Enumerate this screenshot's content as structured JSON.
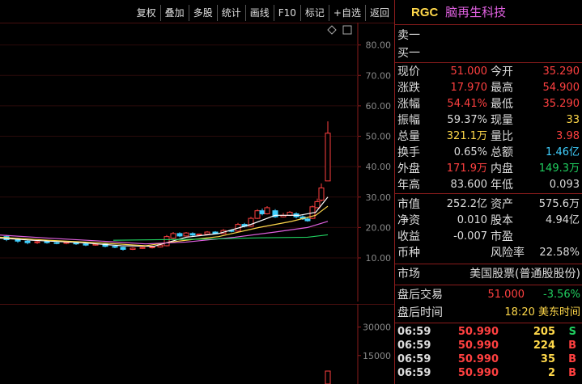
{
  "toolbar": {
    "buttons": [
      "复权",
      "叠加",
      "多股",
      "统计",
      "画线",
      "F10",
      "标记",
      "+自选",
      "返回"
    ]
  },
  "chart": {
    "price_axis": [
      "80.00",
      "70.00",
      "60.00",
      "50.00",
      "40.00",
      "30.00",
      "20.00",
      "10.00"
    ],
    "volume_axis": [
      "30000",
      "15000"
    ]
  },
  "header": {
    "code": "RGC",
    "name": "脑再生科技"
  },
  "orderbook": {
    "sell1": "卖一",
    "buy1": "买一"
  },
  "quote": [
    {
      "l1": "现价",
      "v1": "51.000",
      "c1": "red",
      "l2": "今开",
      "v2": "35.290",
      "c2": "red"
    },
    {
      "l1": "涨跌",
      "v1": "17.970",
      "c1": "red",
      "l2": "最高",
      "v2": "54.900",
      "c2": "red"
    },
    {
      "l1": "涨幅",
      "v1": "54.41%",
      "c1": "red",
      "l2": "最低",
      "v2": "35.290",
      "c2": "red"
    },
    {
      "l1": "振幅",
      "v1": "59.37%",
      "c1": "white",
      "l2": "现量",
      "v2": "33",
      "c2": "yellow"
    },
    {
      "l1": "总量",
      "v1": "321.1万",
      "c1": "yellow",
      "l2": "量比",
      "v2": "3.98",
      "c2": "red"
    },
    {
      "l1": "换手",
      "v1": "0.65%",
      "c1": "white",
      "l2": "总额",
      "v2": "1.46亿",
      "c2": "cyan"
    },
    {
      "l1": "外盘",
      "v1": "171.9万",
      "c1": "red",
      "l2": "内盘",
      "v2": "149.3万",
      "c2": "green"
    },
    {
      "l1": "年高",
      "v1": "83.600",
      "c1": "white",
      "l2": "年低",
      "v2": "0.093",
      "c2": "white"
    }
  ],
  "metrics": [
    {
      "l1": "市值",
      "v1": "252.2亿",
      "l2": "资产",
      "v2": "575.6万"
    },
    {
      "l1": "净资",
      "v1": "0.010",
      "l2": "股本",
      "v2": "4.94亿"
    },
    {
      "l1": "收益",
      "v1": "-0.007",
      "l2": "市盈",
      "v2": ""
    },
    {
      "l1": "币种",
      "v1": "",
      "l2": "风险率",
      "v2": "22.58%"
    }
  ],
  "market": {
    "label": "市场",
    "value": "美国股票(普通股股份)"
  },
  "after_hours": {
    "trade_label": "盘后交易",
    "trade_price": "51.000",
    "trade_change": "-3.56%",
    "time_label": "盘后时间",
    "time_value": "18:20 美东时间"
  },
  "ticks": [
    {
      "time": "06:59",
      "price": "50.990",
      "vol": "205",
      "side": "S",
      "side_color": "green"
    },
    {
      "time": "06:59",
      "price": "50.990",
      "vol": "224",
      "side": "B",
      "side_color": "red"
    },
    {
      "time": "06:59",
      "price": "50.990",
      "vol": "35",
      "side": "B",
      "side_color": "red"
    },
    {
      "time": "06:59",
      "price": "50.990",
      "vol": "2",
      "side": "B",
      "side_color": "red"
    }
  ],
  "colors": {
    "up": "#ff4040",
    "down": "#20d060",
    "accent": "#ffd84a",
    "border": "#8a1c1c"
  }
}
